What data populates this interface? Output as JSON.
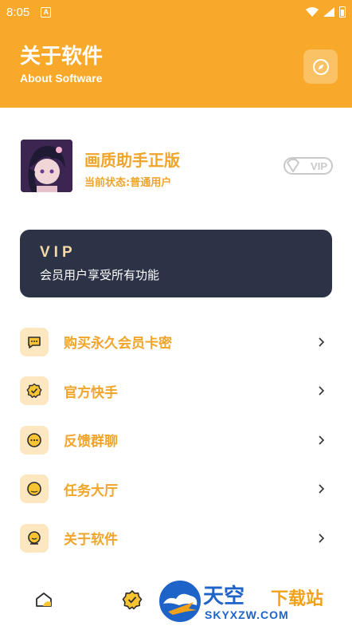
{
  "status_bar": {
    "time": "8:05",
    "notification_letter": "A"
  },
  "header": {
    "title": "关于软件",
    "subtitle": "About Software",
    "accent_color": "#f9a92a",
    "right_icon": "compass-icon"
  },
  "profile": {
    "app_name": "画质助手正版",
    "status": "当前状态:普通用户",
    "badge": "VIP"
  },
  "vip_card": {
    "title": "VIP",
    "description": "会员用户享受所有功能"
  },
  "menu": {
    "items": [
      {
        "label": "购买永久会员卡密",
        "icon": "chat-bubble-icon"
      },
      {
        "label": "官方快手",
        "icon": "badge-check-icon"
      },
      {
        "label": "反馈群聊",
        "icon": "message-dots-icon"
      },
      {
        "label": "任务大厅",
        "icon": "circle-icon"
      },
      {
        "label": "关于软件",
        "icon": "info-icon"
      }
    ]
  },
  "bottom_nav": {
    "items": [
      {
        "icon": "home-icon"
      },
      {
        "icon": "badge-check-icon"
      }
    ]
  },
  "watermark": {
    "line1": "天空",
    "line2": "下载站",
    "line3": "SKYXZW.COM"
  }
}
